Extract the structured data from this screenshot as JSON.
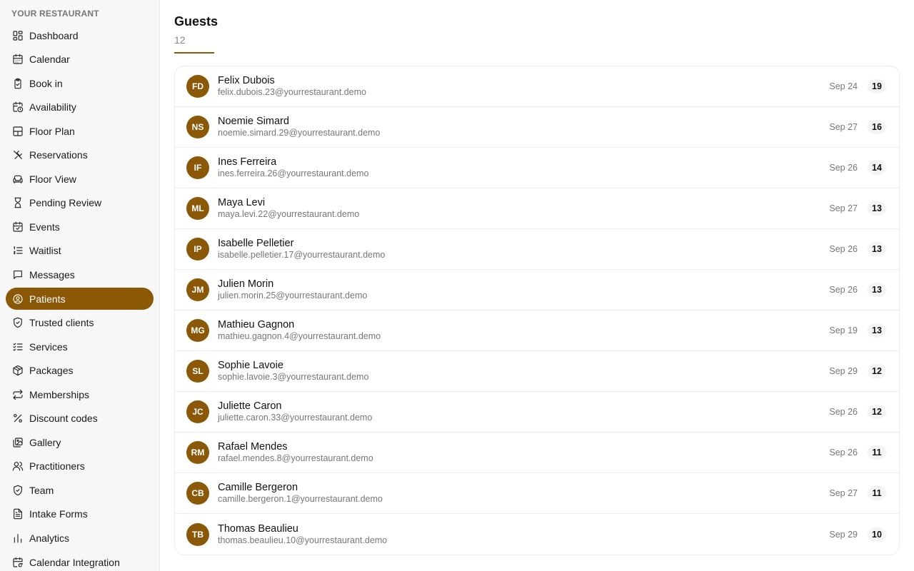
{
  "sidebar": {
    "brand": "YOUR RESTAURANT",
    "items": [
      {
        "label": "Dashboard",
        "icon": "dashboard-icon"
      },
      {
        "label": "Calendar",
        "icon": "calendar-icon"
      },
      {
        "label": "Book in",
        "icon": "clipboard-icon"
      },
      {
        "label": "Availability",
        "icon": "calendar-clock-icon"
      },
      {
        "label": "Floor Plan",
        "icon": "layout-icon"
      },
      {
        "label": "Reservations",
        "icon": "utensils-icon"
      },
      {
        "label": "Floor View",
        "icon": "armchair-icon"
      },
      {
        "label": "Pending Review",
        "icon": "hourglass-icon"
      },
      {
        "label": "Events",
        "icon": "calendar-check-icon"
      },
      {
        "label": "Waitlist",
        "icon": "list-ordered-icon"
      },
      {
        "label": "Messages",
        "icon": "message-icon"
      },
      {
        "label": "Patients",
        "icon": "user-circle-icon",
        "active": true
      },
      {
        "label": "Trusted clients",
        "icon": "shield-check-icon"
      },
      {
        "label": "Services",
        "icon": "list-checks-icon"
      },
      {
        "label": "Packages",
        "icon": "package-icon"
      },
      {
        "label": "Memberships",
        "icon": "repeat-icon"
      },
      {
        "label": "Discount codes",
        "icon": "percent-icon"
      },
      {
        "label": "Gallery",
        "icon": "images-icon"
      },
      {
        "label": "Practitioners",
        "icon": "users-icon"
      },
      {
        "label": "Team",
        "icon": "shield-icon"
      },
      {
        "label": "Intake Forms",
        "icon": "file-text-icon"
      },
      {
        "label": "Analytics",
        "icon": "bar-chart-icon"
      },
      {
        "label": "Calendar Integration",
        "icon": "calendar-sync-icon"
      }
    ]
  },
  "main": {
    "title": "Guests",
    "count": "12",
    "guests": [
      {
        "initials": "FD",
        "name": "Felix Dubois",
        "email": "felix.dubois.23@yourrestaurant.demo",
        "date": "Sep 24",
        "visits": "19"
      },
      {
        "initials": "NS",
        "name": "Noemie Simard",
        "email": "noemie.simard.29@yourrestaurant.demo",
        "date": "Sep 27",
        "visits": "16"
      },
      {
        "initials": "IF",
        "name": "Ines Ferreira",
        "email": "ines.ferreira.26@yourrestaurant.demo",
        "date": "Sep 26",
        "visits": "14"
      },
      {
        "initials": "ML",
        "name": "Maya Levi",
        "email": "maya.levi.22@yourrestaurant.demo",
        "date": "Sep 27",
        "visits": "13"
      },
      {
        "initials": "IP",
        "name": "Isabelle Pelletier",
        "email": "isabelle.pelletier.17@yourrestaurant.demo",
        "date": "Sep 26",
        "visits": "13"
      },
      {
        "initials": "JM",
        "name": "Julien Morin",
        "email": "julien.morin.25@yourrestaurant.demo",
        "date": "Sep 26",
        "visits": "13"
      },
      {
        "initials": "MG",
        "name": "Mathieu Gagnon",
        "email": "mathieu.gagnon.4@yourrestaurant.demo",
        "date": "Sep 19",
        "visits": "13"
      },
      {
        "initials": "SL",
        "name": "Sophie Lavoie",
        "email": "sophie.lavoie.3@yourrestaurant.demo",
        "date": "Sep 29",
        "visits": "12"
      },
      {
        "initials": "JC",
        "name": "Juliette Caron",
        "email": "juliette.caron.33@yourrestaurant.demo",
        "date": "Sep 26",
        "visits": "12"
      },
      {
        "initials": "RM",
        "name": "Rafael Mendes",
        "email": "rafael.mendes.8@yourrestaurant.demo",
        "date": "Sep 26",
        "visits": "11"
      },
      {
        "initials": "CB",
        "name": "Camille Bergeron",
        "email": "camille.bergeron.1@yourrestaurant.demo",
        "date": "Sep 27",
        "visits": "11"
      },
      {
        "initials": "TB",
        "name": "Thomas Beaulieu",
        "email": "thomas.beaulieu.10@yourrestaurant.demo",
        "date": "Sep 29",
        "visits": "10"
      }
    ]
  },
  "colors": {
    "accent": "#8a5806",
    "sidebar_bg": "#f7f7f7"
  }
}
